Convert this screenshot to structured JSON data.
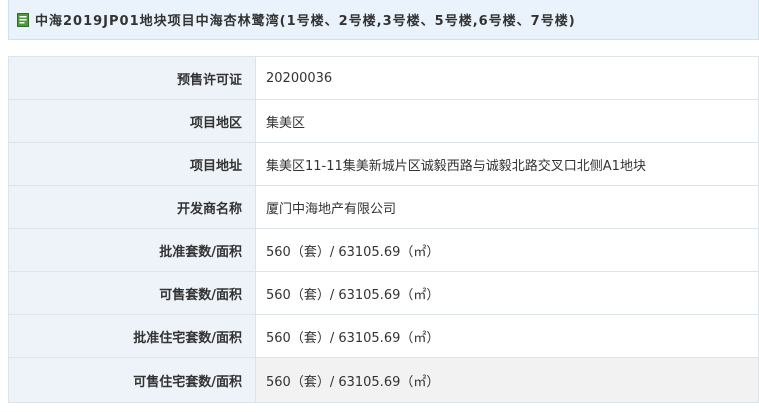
{
  "header": {
    "title": "中海2019JP01地块项目中海杏林鹭湾(1号楼、2号楼,3号楼、5号楼,6号楼、7号楼)",
    "icon": "document-icon",
    "background": "#eaf3fb"
  },
  "rows": [
    {
      "label": "预售许可证",
      "value": "20200036"
    },
    {
      "label": "项目地区",
      "value": "集美区"
    },
    {
      "label": "项目地址",
      "value": "集美区11-11集美新城片区诚毅西路与诚毅北路交叉口北侧A1地块"
    },
    {
      "label": "开发商名称",
      "value": "厦门中海地产有限公司"
    },
    {
      "label": "批准套数/面积",
      "value": "560（套）/ 63105.69（㎡）"
    },
    {
      "label": "可售套数/面积",
      "value": "560（套）/ 63105.69（㎡）"
    },
    {
      "label": "批准住宅套数/面积",
      "value": "560（套）/ 63105.69（㎡）"
    },
    {
      "label": "可售住宅套数/面积",
      "value": "560（套）/ 63105.69（㎡）"
    }
  ],
  "colors": {
    "label_bg": "#edf3f8",
    "border": "#dde4ea",
    "highlight_row_bg": "#f2f2f2"
  }
}
